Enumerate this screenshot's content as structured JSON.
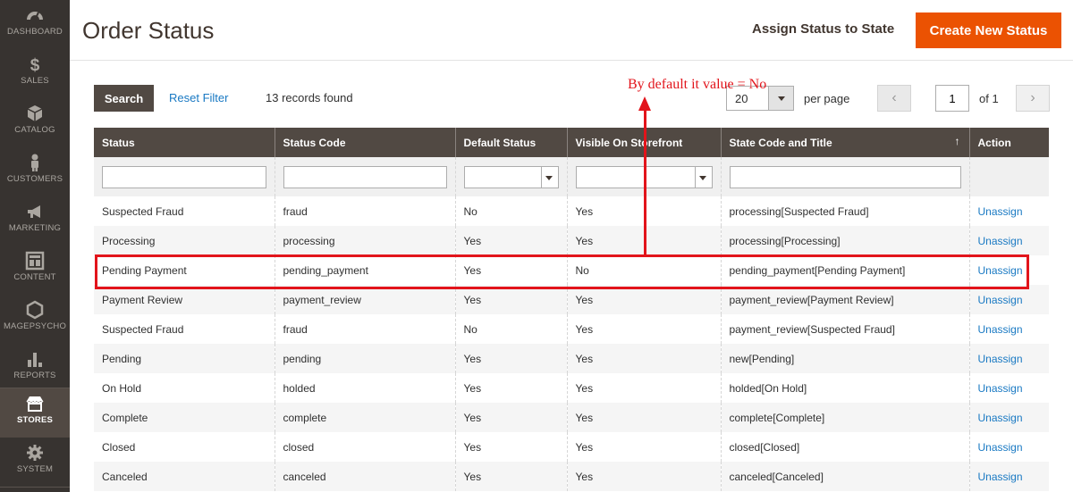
{
  "sidebar": {
    "items": [
      {
        "label": "DASHBOARD",
        "icon": "dashboard-icon"
      },
      {
        "label": "SALES",
        "icon": "dollar-icon"
      },
      {
        "label": "CATALOG",
        "icon": "cube-icon"
      },
      {
        "label": "CUSTOMERS",
        "icon": "person-icon"
      },
      {
        "label": "MARKETING",
        "icon": "megaphone-icon"
      },
      {
        "label": "CONTENT",
        "icon": "layout-icon"
      },
      {
        "label": "MAGEPSYCHO",
        "icon": "hexagon-icon"
      },
      {
        "label": "REPORTS",
        "icon": "bar-chart-icon"
      },
      {
        "label": "STORES",
        "icon": "store-icon"
      },
      {
        "label": "SYSTEM",
        "icon": "gear-icon"
      }
    ],
    "active": "STORES"
  },
  "header": {
    "title": "Order Status",
    "assign_label": "Assign Status to State",
    "create_label": "Create New Status"
  },
  "toolbar": {
    "search_label": "Search",
    "reset_label": "Reset Filter",
    "records": "13 records found",
    "per_page_value": "20",
    "per_page_label": "per page",
    "prev": "‹",
    "next": "›",
    "page_value": "1",
    "of_label": "of 1"
  },
  "annotation": {
    "text": "By default it value = No",
    "color": "#e2141b"
  },
  "grid": {
    "columns": [
      "Status",
      "Status Code",
      "Default Status",
      "Visible On Storefront",
      "State Code and Title",
      "Action"
    ],
    "sort_indicator": "↑",
    "rows": [
      [
        "Suspected Fraud",
        "fraud",
        "No",
        "Yes",
        "processing[Suspected Fraud]",
        "Unassign"
      ],
      [
        "Processing",
        "processing",
        "Yes",
        "Yes",
        "processing[Processing]",
        "Unassign"
      ],
      [
        "Pending Payment",
        "pending_payment",
        "Yes",
        "No",
        "pending_payment[Pending Payment]",
        "Unassign"
      ],
      [
        "Payment Review",
        "payment_review",
        "Yes",
        "Yes",
        "payment_review[Payment Review]",
        "Unassign"
      ],
      [
        "Suspected Fraud",
        "fraud",
        "No",
        "Yes",
        "payment_review[Suspected Fraud]",
        "Unassign"
      ],
      [
        "Pending",
        "pending",
        "Yes",
        "Yes",
        "new[Pending]",
        "Unassign"
      ],
      [
        "On Hold",
        "holded",
        "Yes",
        "Yes",
        "holded[On Hold]",
        "Unassign"
      ],
      [
        "Complete",
        "complete",
        "Yes",
        "Yes",
        "complete[Complete]",
        "Unassign"
      ],
      [
        "Closed",
        "closed",
        "Yes",
        "Yes",
        "closed[Closed]",
        "Unassign"
      ],
      [
        "Canceled",
        "canceled",
        "Yes",
        "Yes",
        "canceled[Canceled]",
        "Unassign"
      ]
    ]
  },
  "colors": {
    "accent": "#eb5202",
    "link": "#1979c3",
    "header_bg": "#514943",
    "sidebar_bg": "#373330"
  }
}
